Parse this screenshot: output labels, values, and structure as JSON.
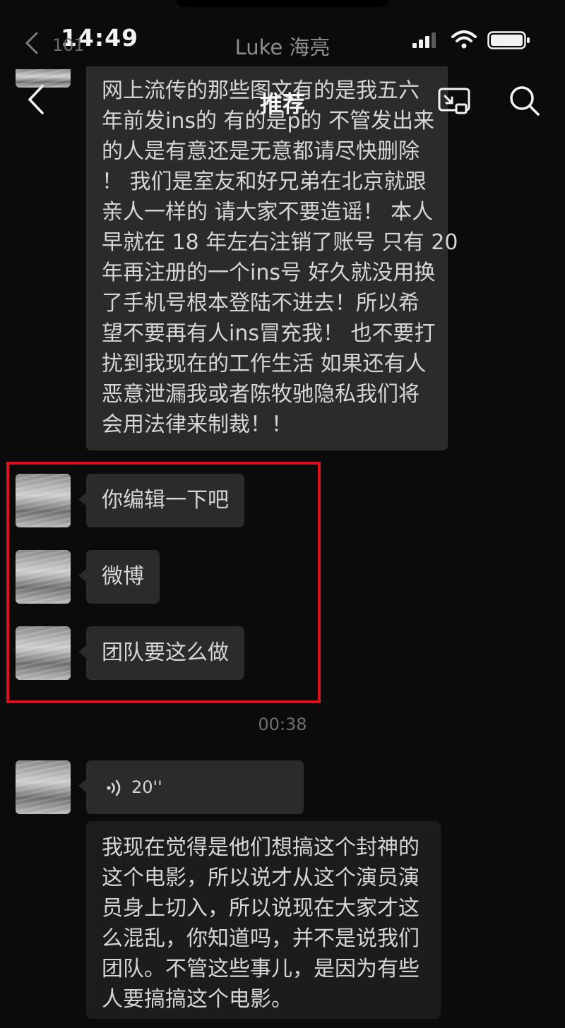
{
  "status_bar": {
    "time": "14:49"
  },
  "chat_header": {
    "unread_count": "101",
    "title": "Luke 海亮"
  },
  "overlay": {
    "title": "推荐"
  },
  "messages": {
    "long_text_lines": [
      "网上流传的那些图文有的是我五六",
      "年前发ins的 有的是p的 不管发出来",
      "的人是有意还是无意都请尽快删除",
      "！ 我们是室友和好兄弟在北京就跟",
      "亲人一样的 请大家不要造谣！ 本人",
      "早就在 18 年左右注销了账号 只有 20",
      "年再注册的一个ins号 好久就没用换",
      "了手机号根本登陆不进去！所以希",
      "望不要再有人ins冒充我！ 也不要打",
      "扰到我现在的工作生活 如果还有人",
      "恶意泄漏我或者陈牧驰隐私我们将",
      "会用法律来制裁！！"
    ],
    "msg1": "你编辑一下吧",
    "msg2": "微博",
    "msg3": "团队要这么做",
    "timestamp": "00:38",
    "voice_duration": "20''",
    "transcript_lines": [
      "我现在觉得是他们想搞这个封神的",
      "这个电影，所以说才从这个演员演",
      "员身上切入，所以说现在大家才这",
      "么混乱，你知道吗，并不是说我们",
      "团队。不管这些事儿，是因为有些",
      "人要搞搞这个电影。"
    ]
  },
  "colors": {
    "highlight_border": "#e0101c",
    "bubble": "#2b2b2b",
    "background": "#0b0b0b"
  }
}
